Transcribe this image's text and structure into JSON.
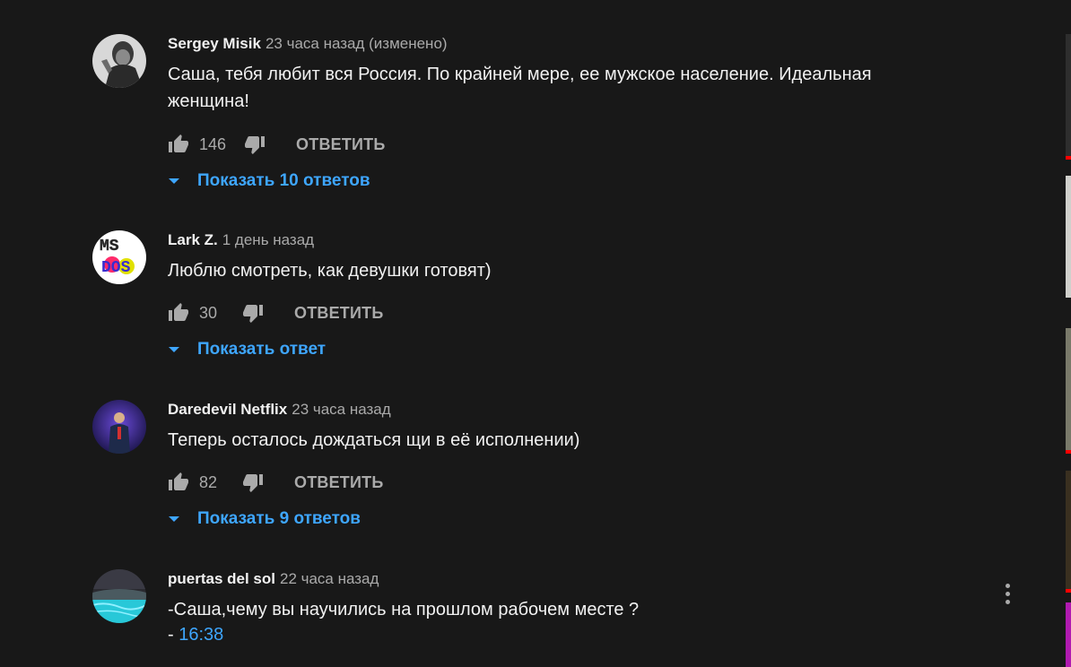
{
  "comments": [
    {
      "author": "Sergey Misik",
      "time": "23 часа назад (изменено)",
      "text": "Саша, тебя любит вся Россия. По крайней мере, ее мужское население. Идеальная женщина!",
      "likes": "146",
      "reply_label": "ОТВЕТИТЬ",
      "replies_label": "Показать 10 ответов"
    },
    {
      "author": "Lark Z.",
      "time": "1 день назад",
      "text": "Люблю смотреть, как девушки готовят)",
      "likes": "30",
      "reply_label": "ОТВЕТИТЬ",
      "replies_label": "Показать ответ"
    },
    {
      "author": "Daredevil Netflix",
      "time": "23 часа назад",
      "text": "Теперь осталось дождаться щи в её исполнении)",
      "likes": "82",
      "reply_label": "ОТВЕТИТЬ",
      "replies_label": "Показать 9 ответов"
    },
    {
      "author": "puertas del sol",
      "time": "22 часа назад",
      "text": "-Саша,чему вы научились на прошлом рабочем месте ?",
      "text2_prefix": "- ",
      "timestamp_link": "16:38"
    }
  ],
  "colors": {
    "background": "#181818",
    "text": "#f1f1f1",
    "secondary": "#aaaaaa",
    "link": "#3ea6ff"
  },
  "icons": [
    "like-icon",
    "dislike-icon",
    "chevron-down-icon",
    "more-vert-icon"
  ]
}
